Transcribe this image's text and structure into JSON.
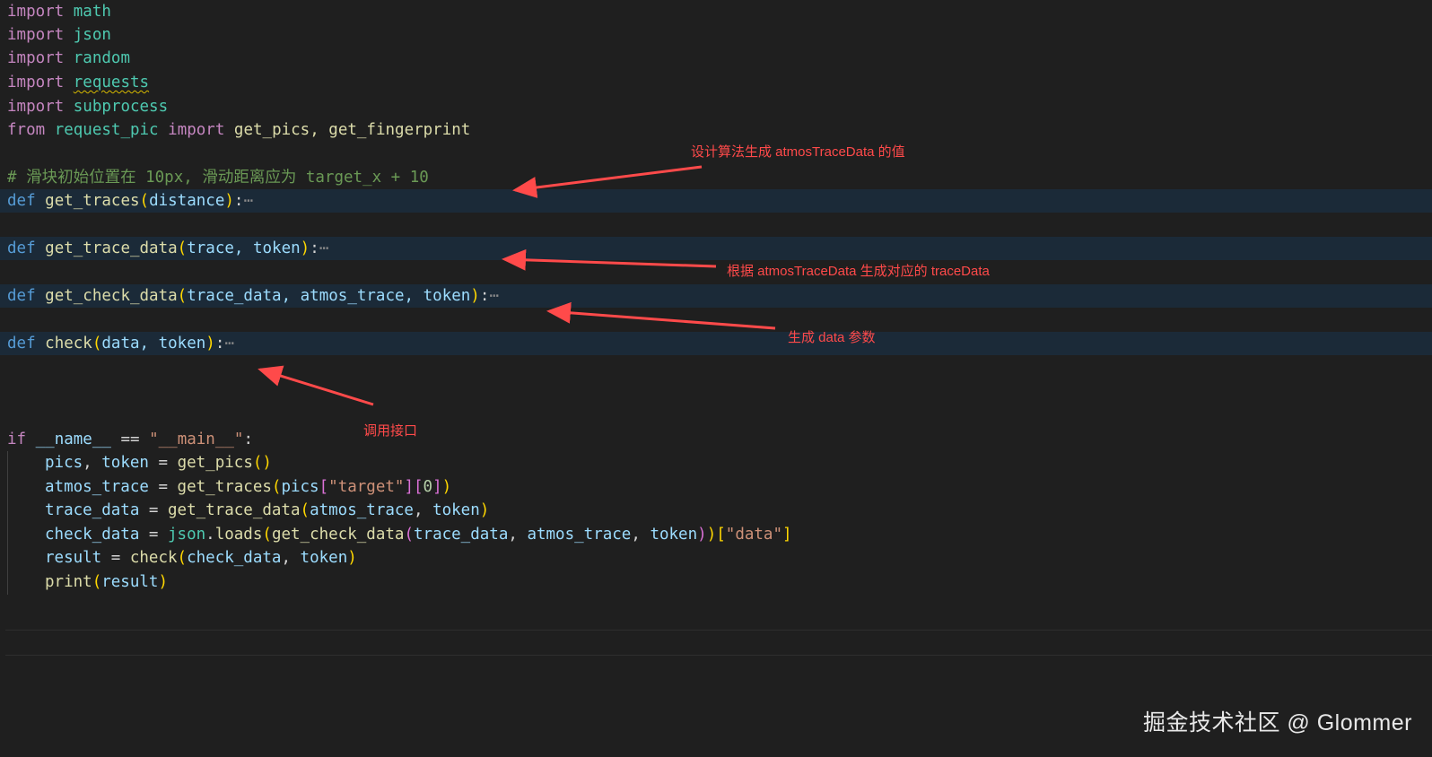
{
  "code": {
    "imports": [
      {
        "keyword": "import",
        "module": "math"
      },
      {
        "keyword": "import",
        "module": "json"
      },
      {
        "keyword": "import",
        "module": "random"
      },
      {
        "keyword": "import",
        "module": "requests"
      },
      {
        "keyword": "import",
        "module": "subprocess"
      }
    ],
    "from_import": {
      "from": "from",
      "module": "request_pic",
      "import": "import",
      "names": "get_pics, get_fingerprint"
    },
    "comment": "# 滑块初始位置在 10px, 滑动距离应为 target_x + 10",
    "folded_defs": [
      {
        "keyword": "def",
        "name": "get_traces",
        "params": "distance",
        "suffix": ":",
        "fold": "⋯"
      },
      {
        "keyword": "def",
        "name": "get_trace_data",
        "params": "trace, token",
        "suffix": ":",
        "fold": "⋯"
      },
      {
        "keyword": "def",
        "name": "get_check_data",
        "params": "trace_data, atmos_trace, token",
        "suffix": ":",
        "fold": "⋯"
      },
      {
        "keyword": "def",
        "name": "check",
        "params": "data, token",
        "suffix": ":",
        "fold": "⋯"
      }
    ],
    "main_guard": {
      "if": "if",
      "name": "__name__",
      "op": "==",
      "value": "\"__main__\"",
      "colon": ":"
    },
    "main_body": [
      "pics, token = get_pics()",
      "atmos_trace = get_traces(pics[\"target\"][0])",
      "trace_data = get_trace_data(atmos_trace, token)",
      "check_data = json.loads(get_check_data(trace_data, atmos_trace, token))[\"data\"]",
      "result = check(check_data, token)",
      "print(result)"
    ]
  },
  "annotations": [
    {
      "text": "设计算法生成 atmosTraceData 的值"
    },
    {
      "text": "根据 atmosTraceData 生成对应的 traceData"
    },
    {
      "text": "生成 data 参数"
    },
    {
      "text": "调用接口"
    }
  ],
  "watermark": "掘金技术社区 @ Glommer",
  "colors": {
    "background": "#1f1f1f",
    "highlight": "#1b2a38",
    "annotation": "#ff4a4a",
    "keyword": "#c586c0",
    "def_keyword": "#569cd6",
    "module": "#4ec9b0",
    "function": "#dcdcaa",
    "variable": "#9cdcfe",
    "string": "#ce9178",
    "comment": "#6a9955"
  }
}
